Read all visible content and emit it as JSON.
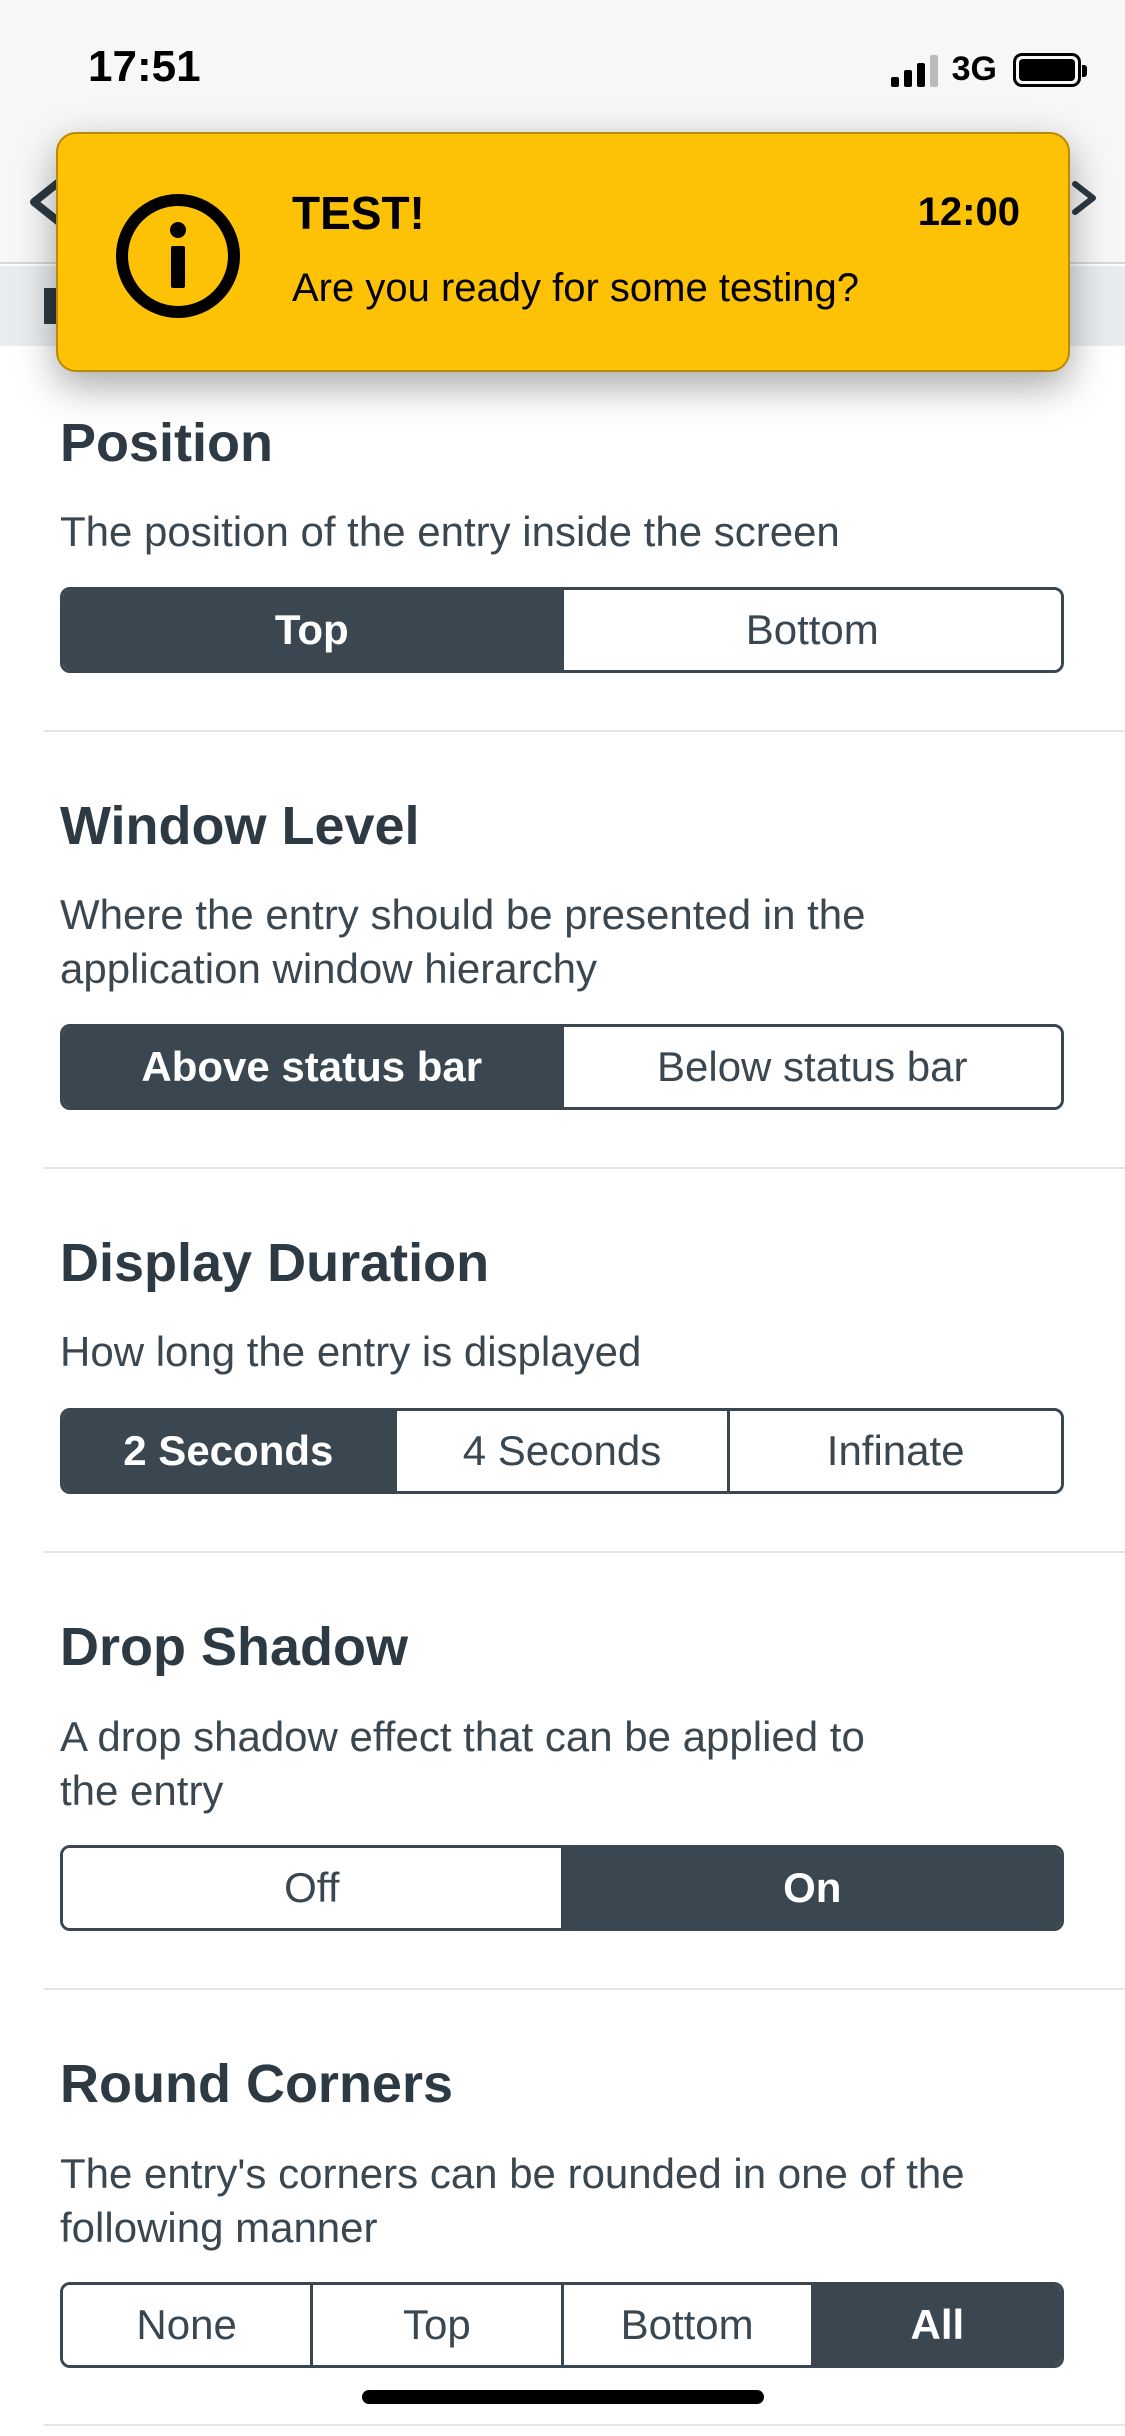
{
  "status_bar": {
    "time": "17:51",
    "network": "3G",
    "icons": [
      "signal-icon",
      "battery-icon"
    ]
  },
  "banner": {
    "title": "TEST!",
    "time": "12:00",
    "message": "Are you ready for some testing?",
    "icon": "info-icon",
    "background_color": "#fdc106"
  },
  "theme": {
    "selected_color": "#3a4750",
    "text_color": "#2d3a43"
  },
  "sections": {
    "position": {
      "title": "Position",
      "description": "The position of the entry inside the screen",
      "options": [
        "Top",
        "Bottom"
      ],
      "selected": "Top"
    },
    "window_level": {
      "title": "Window Level",
      "description_line1": "Where the entry should be presented in the",
      "description_line2": "application window hierarchy",
      "options": [
        "Above status bar",
        "Below status bar"
      ],
      "selected": "Above status bar"
    },
    "display_duration": {
      "title": "Display Duration",
      "description": "How long the entry is displayed",
      "options": [
        "2 Seconds",
        "4 Seconds",
        "Infinate"
      ],
      "selected": "2 Seconds"
    },
    "drop_shadow": {
      "title": "Drop Shadow",
      "description_line1": "A drop shadow effect that can be applied to",
      "description_line2": "the entry",
      "options": [
        "Off",
        "On"
      ],
      "selected": "On"
    },
    "round_corners": {
      "title": "Round Corners",
      "description_line1": "The entry's corners can be rounded in one of the",
      "description_line2": "following manner",
      "options": [
        "None",
        "Top",
        "Bottom",
        "All"
      ],
      "selected": "All"
    }
  }
}
